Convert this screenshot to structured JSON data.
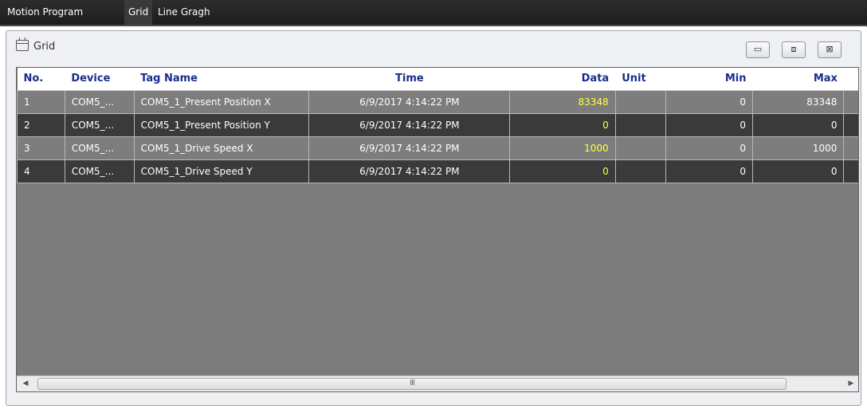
{
  "menubar": {
    "items": [
      {
        "label": "Motion Program"
      },
      {
        "label": "Grid"
      },
      {
        "label": "Line Gragh"
      }
    ]
  },
  "panel": {
    "title": "Grid",
    "title_icon": "grid-window-icon",
    "window_buttons": {
      "minimize": "▭",
      "restore": "⧈",
      "close": "⊠"
    }
  },
  "table": {
    "columns": [
      "No.",
      "Device",
      "Tag Name",
      "Time",
      "Data",
      "Unit",
      "Min",
      "Max"
    ],
    "rows": [
      {
        "no": "1",
        "device": "COM5_...",
        "tag": "COM5_1_Present Position X",
        "time": "6/9/2017 4:14:22 PM",
        "data": "83348",
        "unit": "",
        "min": "0",
        "max": "83348"
      },
      {
        "no": "2",
        "device": "COM5_...",
        "tag": "COM5_1_Present Position Y",
        "time": "6/9/2017 4:14:22 PM",
        "data": "0",
        "unit": "",
        "min": "0",
        "max": "0"
      },
      {
        "no": "3",
        "device": "COM5_...",
        "tag": "COM5_1_Drive Speed X",
        "time": "6/9/2017 4:14:22 PM",
        "data": "1000",
        "unit": "",
        "min": "0",
        "max": "1000"
      },
      {
        "no": "4",
        "device": "COM5_...",
        "tag": "COM5_1_Drive Speed Y",
        "time": "6/9/2017 4:14:22 PM",
        "data": "0",
        "unit": "",
        "min": "0",
        "max": "0"
      }
    ]
  },
  "scrollbar": {
    "left_arrow": "◀",
    "right_arrow": "▶",
    "grip": "III"
  },
  "colors": {
    "header_text": "#1a2d8a",
    "data_value": "#ffff3c",
    "row_light": "#7d7d7d",
    "row_dark": "#3a3a3a"
  }
}
